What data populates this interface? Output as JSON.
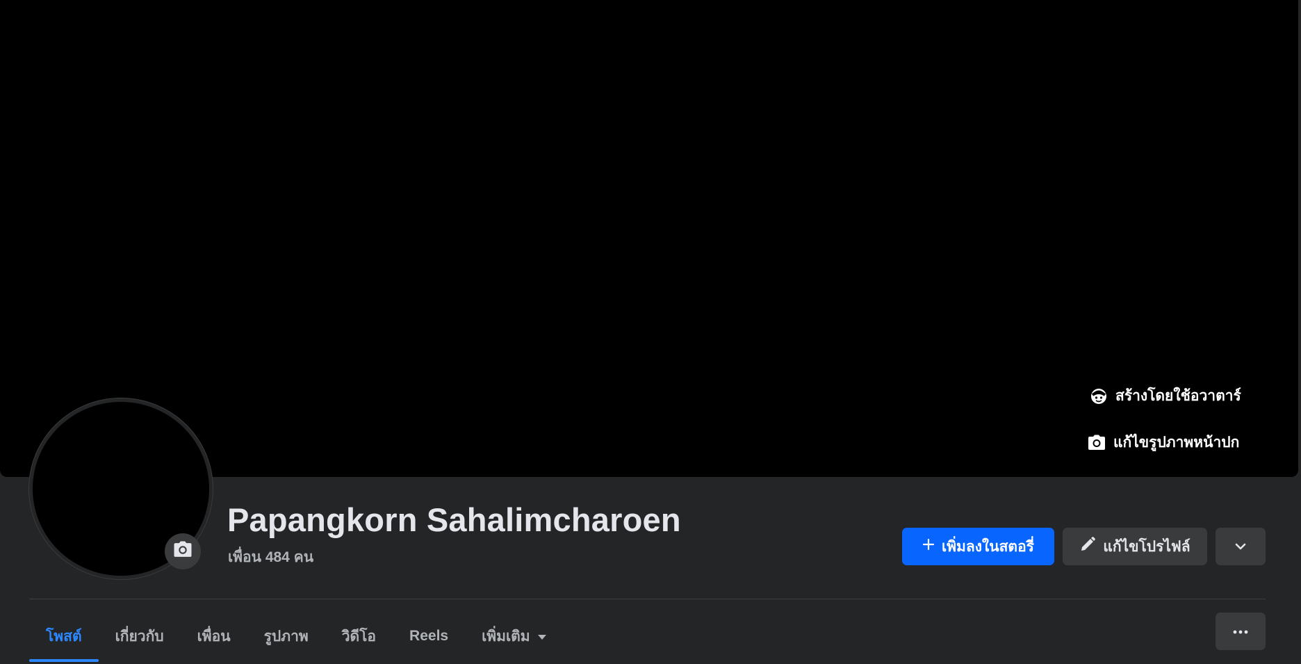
{
  "cover": {
    "avatar_button_label": "สร้างโดยใช้อวาตาร์",
    "edit_cover_label": "แก้ไขรูปภาพหน้าปก"
  },
  "profile": {
    "name": "Papangkorn Sahalimcharoen",
    "friends_text": "เพื่อน 484 คน"
  },
  "actions": {
    "add_story_label": "เพิ่มลงในสตอรี่",
    "edit_profile_label": "แก้ไขโปรไฟล์"
  },
  "tabs": [
    {
      "label": "โพสต์",
      "active": true
    },
    {
      "label": "เกี่ยวกับ"
    },
    {
      "label": "เพื่อน"
    },
    {
      "label": "รูปภาพ"
    },
    {
      "label": "วิดีโอ"
    },
    {
      "label": "Reels"
    },
    {
      "label": "เพิ่มเติม"
    }
  ],
  "colors": {
    "background": "#242526",
    "cover": "#000000",
    "primary": "#0866ff",
    "active_tab": "#2d88ff",
    "secondary_button": "#3a3b3c"
  }
}
